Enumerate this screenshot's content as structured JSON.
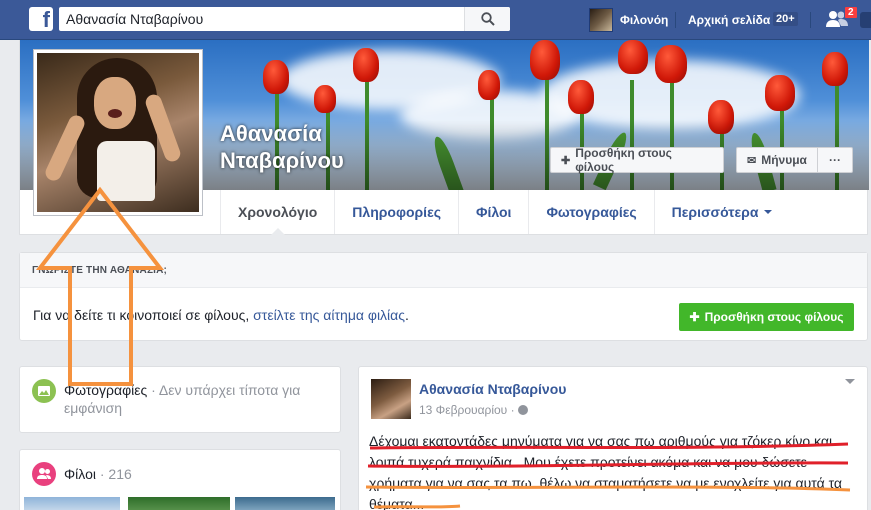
{
  "topbar": {
    "logo": "f",
    "search_value": "Αθανασία Νταβαρίνου",
    "user_name": "Φιλονόη",
    "home_label": "Αρχική σελίδα",
    "home_badge": "20+",
    "friend_requests_count": "2"
  },
  "profile": {
    "name_line1": "Αθανασία",
    "name_line2": "Νταβαρίνου",
    "add_friend_label": "Προσθήκη στους φίλους",
    "message_label": "Μήνυμα",
    "more_label": "···"
  },
  "tabs": [
    {
      "label": "Χρονολόγιο"
    },
    {
      "label": "Πληροφορίες"
    },
    {
      "label": "Φίλοι"
    },
    {
      "label": "Φωτογραφίες"
    },
    {
      "label": "Περισσότερα"
    }
  ],
  "know": {
    "heading": "ΓΝΩΡΙΣΤΕ ΤΗΝ ΑΘΑΝΑΣΙΑ;",
    "body_text": "Για να δείτε τι κοινοποιεί σε φίλους, ",
    "body_link": "στείλτε της αίτημα φιλίας",
    "body_end": ".",
    "button_label": "Προσθήκη στους φίλους"
  },
  "photos_card": {
    "title": "Φωτογραφίες",
    "subtitle": " · Δεν υπάρχει τίποτα για εμφάνιση"
  },
  "friends_card": {
    "title": "Φίλοι",
    "count": " · 216"
  },
  "post": {
    "author": "Αθανασία Νταβαρίνου",
    "date": "13 Φεβρουαρίου · ",
    "text": "Δέχομαι εκατοντάδες μηνύματα για να σας πω αριθμούς για τζόκερ κίνο και λοιπά τυχερά παιχνίδια...Μου έχετε προτείνει ακόμα και να μου δώσετε χρήματα για να σας τα πω..θέλω να σταματήσετε να με ενοχλείτε για αυτά τα θέματα..."
  },
  "colors": {
    "facebook_blue": "#3b5998",
    "link_blue": "#365899",
    "green": "#42b72a",
    "annotation_orange": "#f5923e",
    "annotation_red": "#e0202a"
  }
}
